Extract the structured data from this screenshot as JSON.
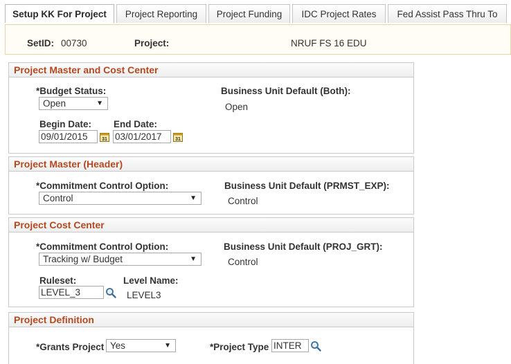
{
  "tabs": [
    {
      "label": "Setup KK For Project",
      "active": true
    },
    {
      "label": "Project Reporting"
    },
    {
      "label": "Project Funding"
    },
    {
      "label": "IDC Project Rates"
    },
    {
      "label": "Fed Assist Pass Thru To"
    }
  ],
  "header": {
    "setid_label": "SetID:",
    "setid_value": "00730",
    "project_label": "Project:",
    "project_value": "NRUF FS 16 EDU"
  },
  "master_cost_center": {
    "title": "Project Master and Cost Center",
    "budget_status_label": "*Budget Status:",
    "budget_status_value": "Open",
    "bu_default_label": "Business Unit Default (Both):",
    "bu_default_value": "Open",
    "begin_date_label": "Begin Date:",
    "begin_date_value": "09/01/2015",
    "end_date_label": "End Date:",
    "end_date_value": "03/01/2017"
  },
  "master_header": {
    "title": "Project Master (Header)",
    "cc_option_label": "*Commitment Control Option:",
    "cc_option_value": "Control",
    "bu_default_label": "Business Unit Default (PRMST_EXP):",
    "bu_default_value": "Control"
  },
  "cost_center": {
    "title": "Project Cost Center",
    "cc_option_label": "*Commitment Control Option:",
    "cc_option_value": "Tracking w/ Budget",
    "bu_default_label": "Business Unit Default (PROJ_GRT):",
    "bu_default_value": "Control",
    "ruleset_label": "Ruleset:",
    "ruleset_value": "LEVEL_3",
    "level_name_label": "Level Name:",
    "level_name_value": "LEVEL3"
  },
  "definition": {
    "title": "Project Definition",
    "grants_label": "*Grants Project",
    "grants_value": "Yes",
    "type_label": "*Project Type",
    "type_value": "INTER"
  },
  "icons": {
    "calendar": "calendar-icon",
    "lookup": "magnifier-icon",
    "dropdown": "chevron-down-icon"
  },
  "colors": {
    "section_title": "#b4491f",
    "header_border": "#e9d6a6"
  }
}
